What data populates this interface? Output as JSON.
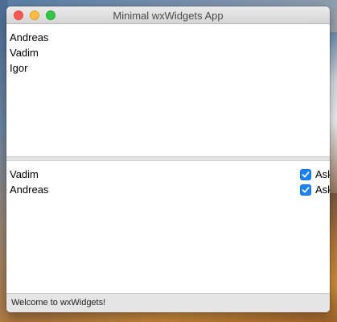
{
  "window": {
    "title": "Minimal wxWidgets App"
  },
  "top_list": {
    "items": [
      "Andreas",
      "Vadim",
      "Igor"
    ]
  },
  "bottom_list": {
    "rows": [
      {
        "name": "Vadim",
        "checkbox_label": "Ask",
        "checked": true
      },
      {
        "name": "Andreas",
        "checkbox_label": "Ask",
        "checked": true
      }
    ]
  },
  "status_bar": {
    "text": "Welcome to wxWidgets!"
  },
  "colors": {
    "checkbox_accent": "#1a82fb",
    "close": "#fc5753",
    "minimize": "#fdbc40",
    "maximize": "#33c748"
  }
}
